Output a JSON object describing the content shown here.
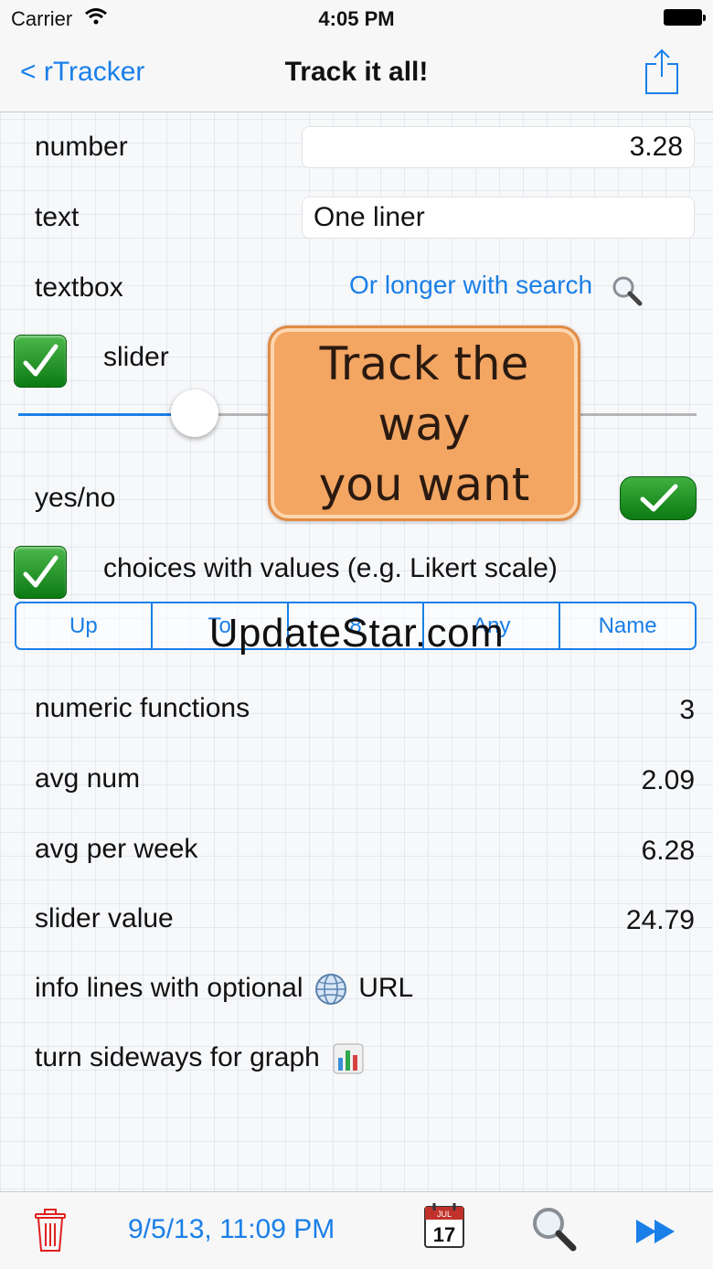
{
  "status_bar": {
    "carrier": "Carrier",
    "time": "4:05 PM"
  },
  "nav": {
    "back_label": "< rTracker",
    "title": "Track it all!"
  },
  "rows": {
    "number": {
      "label": "number",
      "value": "3.28"
    },
    "text": {
      "label": "text",
      "value": "One liner"
    },
    "textbox": {
      "label": "textbox",
      "link": "Or longer with search"
    },
    "slider": {
      "label": "slider",
      "value_fraction": 0.26
    },
    "yesno": {
      "label": "yes/no",
      "checked": true
    },
    "choices": {
      "label": "choices with values (e.g. Likert scale)",
      "options": [
        "Up",
        "To",
        "8",
        "Any",
        "Name"
      ]
    }
  },
  "overlay_text": [
    "Track the",
    "way",
    "you want"
  ],
  "watermark": "UpdateStar.com",
  "stats": [
    {
      "label": "numeric functions",
      "value": "3"
    },
    {
      "label": "avg num",
      "value": "2.09"
    },
    {
      "label": "avg per week",
      "value": "6.28"
    },
    {
      "label": "slider value",
      "value": "24.79"
    }
  ],
  "info": {
    "prefix": "info lines with optional",
    "suffix": "URL"
  },
  "graph_hint": "turn sideways for graph",
  "toolbar": {
    "date": "9/5/13, 11:09 PM",
    "calendar_month": "JUL",
    "calendar_day": "17"
  },
  "colors": {
    "accent": "#1a7fe8",
    "check_green": "#17901d",
    "overlay_orange": "#f3a562"
  }
}
